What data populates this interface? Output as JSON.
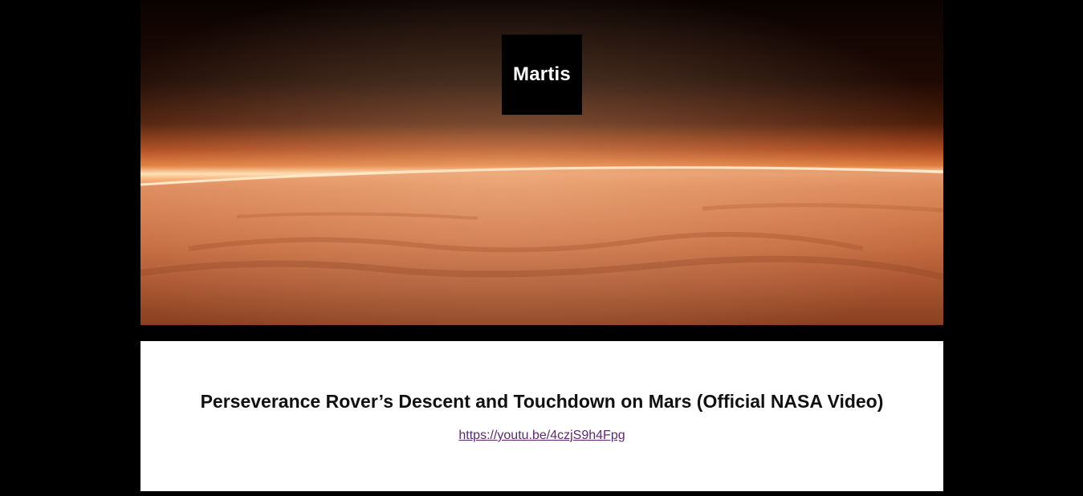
{
  "site": {
    "title": "Martis"
  },
  "post": {
    "title": "Perseverance Rover’s Descent and Touchdown on Mars (Official NASA Video)",
    "link_text": "https://youtu.be/4czjS9h4Fpg",
    "link_href": "https://youtu.be/4czjS9h4Fpg"
  },
  "colors": {
    "background": "#000000",
    "content_bg": "#ffffff",
    "link": "#5b2a6e"
  },
  "hero": {
    "image": "mars-horizon-from-orbit"
  }
}
